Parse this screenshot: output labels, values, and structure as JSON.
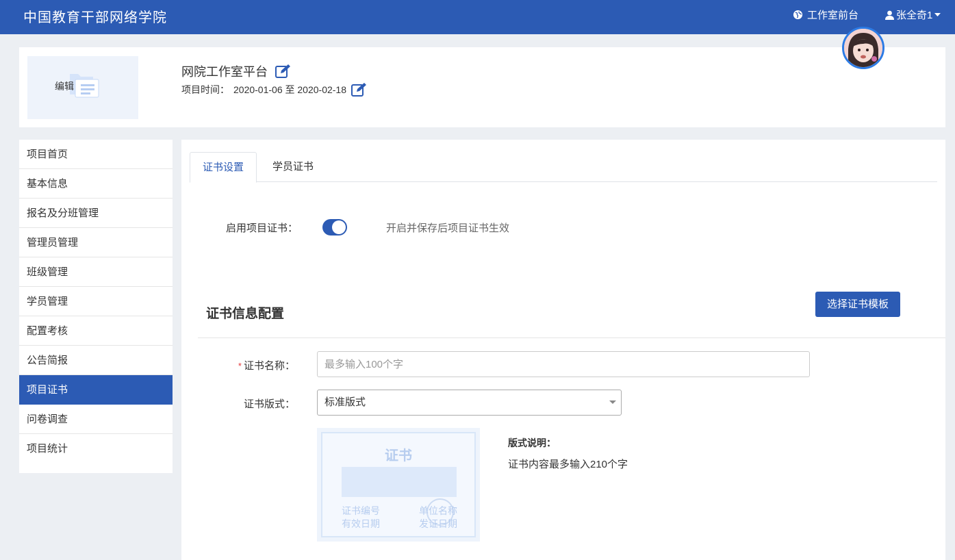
{
  "topbar": {
    "brand": "中国教育干部网络学院",
    "front_link": "工作室前台",
    "user_name": "张全奇1"
  },
  "project": {
    "cover_label": "编辑",
    "title": "网院工作室平台",
    "time_label": "项目时间：",
    "time_value": "2020-01-06 至 2020-02-18"
  },
  "sidebar": {
    "items": [
      {
        "label": "项目首页"
      },
      {
        "label": "基本信息"
      },
      {
        "label": "报名及分班管理"
      },
      {
        "label": "管理员管理"
      },
      {
        "label": "班级管理"
      },
      {
        "label": "学员管理"
      },
      {
        "label": "配置考核"
      },
      {
        "label": "公告简报"
      },
      {
        "label": "项目证书",
        "active": true
      },
      {
        "label": "问卷调查"
      },
      {
        "label": "项目统计"
      }
    ]
  },
  "tabs": [
    {
      "label": "证书设置",
      "active": true
    },
    {
      "label": "学员证书"
    }
  ],
  "certificate": {
    "enable_label": "启用项目证书：",
    "enable_state": "on",
    "enable_hint": "开启并保存后项目证书生效",
    "section_title": "证书信息配置",
    "template_button": "选择证书模板",
    "name_required_mark": "*",
    "name_label": "证书名称：",
    "name_placeholder": "最多输入100个字",
    "name_value": "",
    "format_label": "证书版式：",
    "format_value": "标准版式",
    "preview": {
      "title": "证书",
      "number_label": "证书编号",
      "date_label": "有效日期",
      "org_label": "单位名称",
      "issue_label": "发证日期"
    },
    "format_desc_title": "版式说明：",
    "format_desc_text": "证书内容最多输入210个字"
  },
  "colors": {
    "primary": "#2c5bb4",
    "required": "#e4393c"
  }
}
